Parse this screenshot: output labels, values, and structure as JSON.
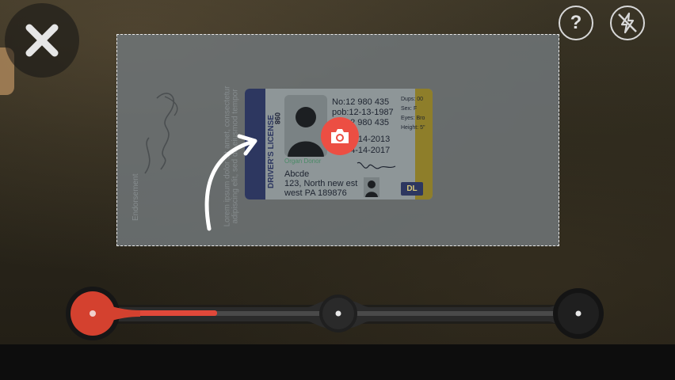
{
  "header": {
    "close_icon": "close-icon",
    "help_icon": "help-icon",
    "help_glyph": "?",
    "flash_icon": "flash-off-icon"
  },
  "scan_area": {
    "license_back": {
      "endorsement_label": "Endorsement",
      "lorem_line1": "Lorem ipsum dolor sit amet, consectetur",
      "lorem_line2": "adipiscing elit, sed do eiusmod tempor"
    },
    "license_front": {
      "title": "DRIVER'S LICENSE",
      "vertical_number": "098",
      "number_line": "No:12 980 435",
      "dob_line": "pob:12-13-1987",
      "line3": "12 980 435",
      "date1": "12-14-2013",
      "date2": "04-14-2017",
      "organ_donor": "Organ Donor",
      "name": "Abcde",
      "address1": "123, North new est",
      "address2": "west PA 189876",
      "dups": "Dups: 00",
      "sex": "Sex: F",
      "eyes": "Eyes: Bro",
      "height": "Height: 5\"",
      "badge": "DL"
    },
    "capture_icon": "camera-icon",
    "guide_icon": "curved-arrow-icon"
  },
  "step_slider": {
    "steps": 3,
    "current_step": 1,
    "active_color": "#e0483a"
  },
  "colors": {
    "accent": "#ec4e43"
  }
}
